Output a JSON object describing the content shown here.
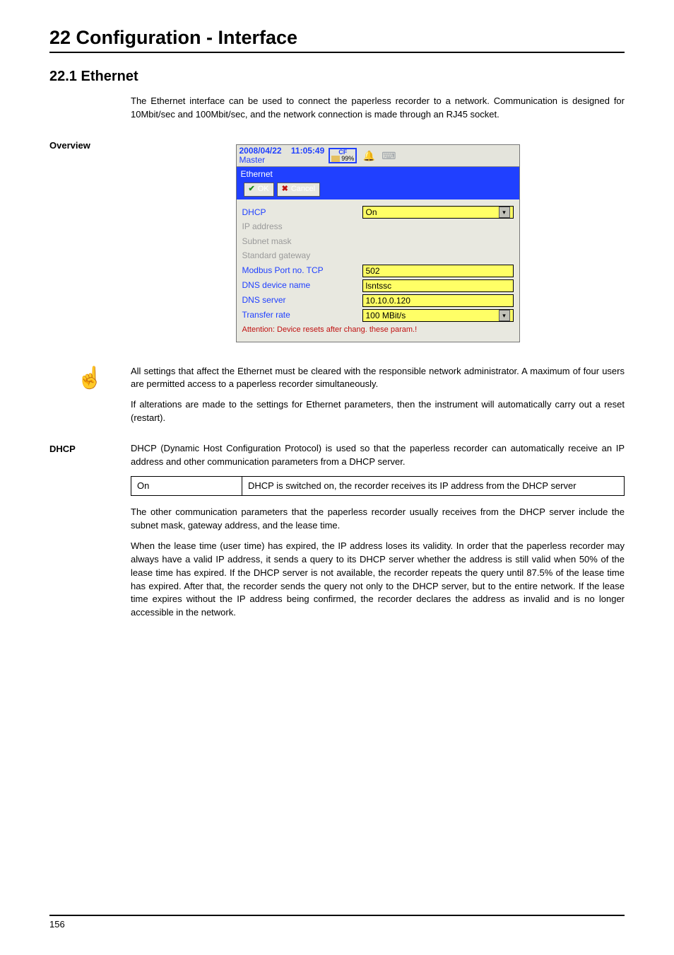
{
  "chapter_title": "22 Configuration - Interface",
  "section_title": "22.1   Ethernet",
  "intro_para": "The Ethernet interface can be used to connect the paperless recorder to a network. Communication is designed for 10Mbit/sec and 100Mbit/sec, and the network connection is made through an RJ45 socket.",
  "overview_label": "Overview",
  "device": {
    "date": "2008/04/22",
    "time": "11:05:49",
    "master": "Master",
    "cf": "CF",
    "cf_pct": "99%",
    "tab": "Ethernet",
    "ok": "OK",
    "cancel": "Cancel",
    "rows": {
      "dhcp_lbl": "DHCP",
      "dhcp_val": "On",
      "ip_lbl": "IP address",
      "subnet_lbl": "Subnet mask",
      "gateway_lbl": "Standard gateway",
      "modbus_lbl": "Modbus Port no. TCP",
      "modbus_val": "502",
      "dnsname_lbl": "DNS device name",
      "dnsname_val": "lsntssc",
      "dnssrv_lbl": "DNS server",
      "dnssrv_val": "10.10.0.120",
      "rate_lbl": "Transfer rate",
      "rate_val": "100 MBit/s"
    },
    "warning": "Attention: Device resets after chang. these param.!"
  },
  "note_p1": "All settings that affect the Ethernet must be cleared with the responsible network administrator. A maximum of four users are permitted access to a paperless recorder simultaneously.",
  "note_p2": "If alterations are made to the settings for Ethernet parameters, then the instrument will automatically carry out a reset (restart).",
  "dhcp_label": "DHCP",
  "dhcp_intro": "DHCP (Dynamic Host Configuration Protocol) is used so that the paperless recorder can automatically receive an IP address and other communication parameters from a DHCP server.",
  "dhcp_table": {
    "c1": "On",
    "c2": "DHCP is switched on, the recorder receives its IP address from the DHCP server"
  },
  "dhcp_para2": "The other communication parameters that the paperless recorder usually receives from the DHCP server include  the subnet mask, gateway address, and the lease time.",
  "dhcp_para3": "When the lease time (user time) has expired, the IP address loses its validity. In order that the paperless recorder may always have a valid IP address, it sends a query to its DHCP server whether the address is still valid when 50% of the lease time has expired. If the DHCP server is not available, the recorder repeats the query until 87.5% of the lease time has expired. After that, the recorder sends the query not only to the DHCP server, but to the entire network. If the lease time expires without the IP address being confirmed, the recorder declares the address as invalid and is no longer accessible in the network.",
  "page_number": "156"
}
